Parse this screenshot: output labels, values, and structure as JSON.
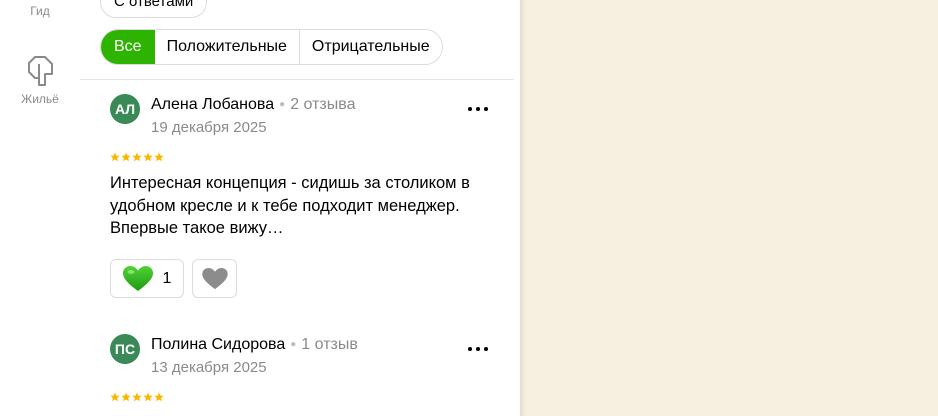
{
  "nav": {
    "guide_label": "Гид",
    "housing_label": "Жильё"
  },
  "filters": {
    "answers_chip": "С ответами",
    "all": "Все",
    "positive": "Положительные",
    "negative": "Отрицательные"
  },
  "colors": {
    "accent_green": "#2db300",
    "avatar_green": "#3a8a57",
    "star_yellow": "#fcb600",
    "map_background": "#f7f0e0"
  },
  "reviews": [
    {
      "initials": "АЛ",
      "name": "Алена Лобанова",
      "count": "2 отзыва",
      "date": "19 декабря 2025",
      "rating": 5,
      "text": "Интересная концепция - сидишь за столиком в удобном кресле и к тебе подходит менеджер. Впервые такое вижу…",
      "likes": "1"
    },
    {
      "initials": "ПС",
      "name": "Полина Сидорова",
      "count": "1 отзыв",
      "date": "13 декабря 2025",
      "rating": 5
    }
  ]
}
